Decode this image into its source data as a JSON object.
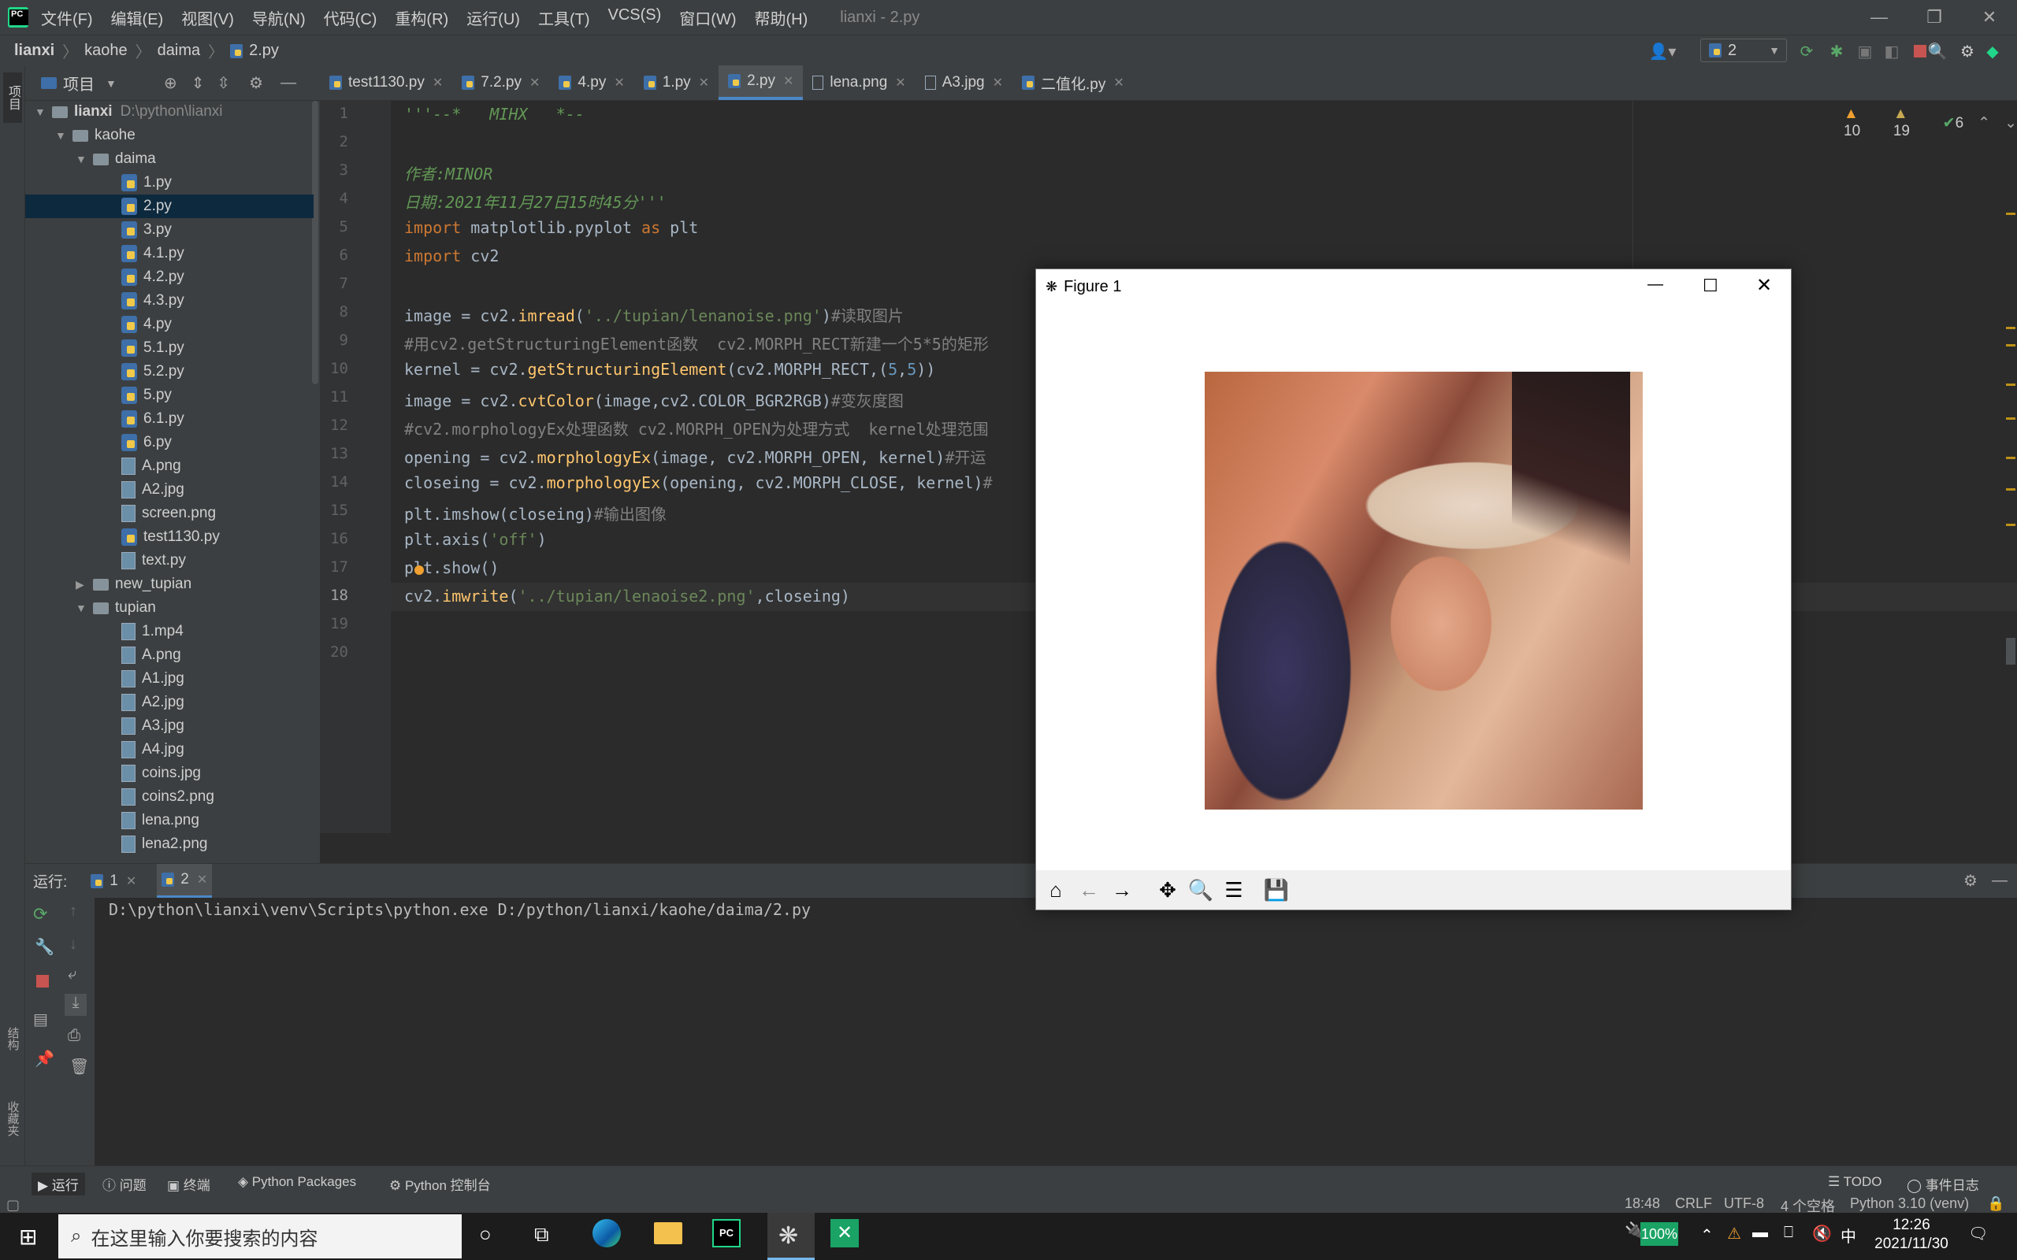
{
  "menu": {
    "items": [
      "文件(F)",
      "编辑(E)",
      "视图(V)",
      "导航(N)",
      "代码(C)",
      "重构(R)",
      "运行(U)",
      "工具(T)",
      "VCS(S)",
      "窗口(W)",
      "帮助(H)"
    ],
    "window_title": "lianxi - 2.py"
  },
  "breadcrumb": [
    "lianxi",
    "kaohe",
    "daima",
    "2.py"
  ],
  "run_config": "2",
  "project": {
    "label": "项目",
    "root": "lianxi",
    "root_path": "D:\\python\\lianxi",
    "rows": [
      "kaohe",
      "daima",
      "1.py",
      "2.py",
      "3.py",
      "4.1.py",
      "4.2.py",
      "4.3.py",
      "4.py",
      "5.1.py",
      "5.2.py",
      "5.py",
      "6.1.py",
      "6.py",
      "A.png",
      "A2.jpg",
      "screen.png",
      "test1130.py",
      "text.py",
      "new_tupian",
      "tupian",
      "1.mp4",
      "A.png",
      "A1.jpg",
      "A2.jpg",
      "A3.jpg",
      "A4.jpg",
      "coins.jpg",
      "coins2.png",
      "lena.png",
      "lena2.png"
    ]
  },
  "tabs": [
    "test1130.py",
    "7.2.py",
    "4.py",
    "1.py",
    "2.py",
    "lena.png",
    "A3.jpg",
    "二值化.py"
  ],
  "inspections": {
    "errors": "10",
    "warnings": "19",
    "ok": "6"
  },
  "line_numbers": [
    "1",
    "2",
    "3",
    "4",
    "5",
    "6",
    "7",
    "8",
    "9",
    "10",
    "11",
    "12",
    "13",
    "14",
    "15",
    "16",
    "17",
    "18",
    "19",
    "20"
  ],
  "code": {
    "l1": "'''--*   MIHX   *--",
    "l3": "作者:MINOR",
    "l4": "日期:2021年11月27日15时45分'''",
    "l5a": "import",
    "l5b": " matplotlib.pyplot ",
    "l5c": "as",
    "l5d": " plt",
    "l6a": "import",
    "l6b": " cv2",
    "l8a": "image = cv2.",
    "l8b": "imread",
    "l8c": "(",
    "l8d": "'../tupian/lenanoise.png'",
    "l8e": ")",
    "l8f": "#读取图片",
    "l9": "#用cv2.getStructuringElement函数  cv2.MORPH_RECT新建一个5*5的矩形",
    "l10a": "kernel = cv2.",
    "l10b": "getStructuringElement",
    "l10c": "(cv2.MORPH_RECT,(",
    "l10d": "5",
    "l10e": ",",
    "l10f": "5",
    "l10g": "))",
    "l11a": "image = cv2.",
    "l11b": "cvtColor",
    "l11c": "(image,cv2.COLOR_BGR2RGB)",
    "l11d": "#变灰度图",
    "l12": "#cv2.morphologyEx处理函数 cv2.MORPH_OPEN为处理方式  kernel处理范围",
    "l13a": "opening = cv2.",
    "l13b": "morphologyEx",
    "l13c": "(image, cv2.MORPH_OPEN, kernel)",
    "l13d": "#开运",
    "l14a": "closeing = cv2.",
    "l14b": "morphologyEx",
    "l14c": "(opening, cv2.MORPH_CLOSE, kernel)",
    "l14d": "#",
    "l15a": "plt.imshow(closeing)",
    "l15b": "#输出图像",
    "l16a": "plt.axis(",
    "l16b": "'off'",
    "l16c": ")",
    "l17": "plt.show()",
    "l18a": "cv2.",
    "l18b": "imwrite",
    "l18c": "(",
    "l18d": "'../tupian/lenaoise2.png'",
    "l18e": ",closeing)"
  },
  "figure": {
    "title": "Figure 1"
  },
  "run": {
    "label": "运行:",
    "tabs": [
      "1",
      "2"
    ],
    "command": "D:\\python\\lianxi\\venv\\Scripts\\python.exe D:/python/lianxi/kaohe/daima/2.py"
  },
  "bottom_tabs": [
    "运行",
    "问题",
    "终端",
    "Python Packages",
    "Python 控制台"
  ],
  "bottom_right": [
    "TODO",
    "事件日志"
  ],
  "status": {
    "position": "18:48",
    "line_sep": "CRLF",
    "encoding": "UTF-8",
    "indent": "4 个空格",
    "interpreter": "Python 3.10 (venv)"
  },
  "side_labels": {
    "structure": "结构",
    "favorites": "收藏夹"
  },
  "taskbar": {
    "search_placeholder": "在这里输入你要搜索的内容",
    "battery": "100%",
    "ime": "中",
    "time": "12:26",
    "date": "2021/11/30"
  }
}
